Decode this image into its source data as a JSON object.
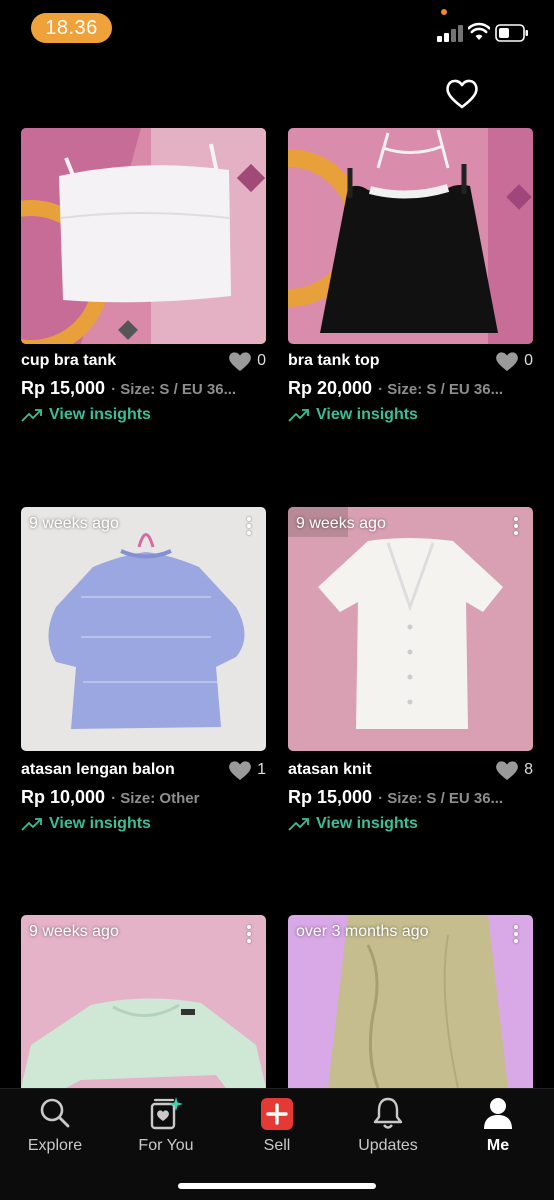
{
  "status_bar": {
    "time": "18.36",
    "time_pill_color": "#f0a23a"
  },
  "header": {
    "icon": "heart-outline-icon"
  },
  "colors": {
    "accent_green": "#3bbf98",
    "background": "#000000",
    "sell_red": "#e53935"
  },
  "listings": [
    {
      "title": "cup bra tank",
      "likes": "0",
      "price": "Rp 15,000",
      "size": "· Size: S / EU 36...",
      "insights": "View insights",
      "posted": ""
    },
    {
      "title": "bra tank top",
      "likes": "0",
      "price": "Rp 20,000",
      "size": "· Size: S / EU 36...",
      "insights": "View insights",
      "posted": ""
    },
    {
      "title": "atasan lengan balon",
      "likes": "1",
      "price": "Rp 10,000",
      "size": "· Size: Other",
      "insights": "View insights",
      "posted": "9 weeks ago"
    },
    {
      "title": "atasan knit",
      "likes": "8",
      "price": "Rp 15,000",
      "size": "· Size: S / EU 36...",
      "insights": "View insights",
      "posted": "9 weeks ago"
    },
    {
      "title": "",
      "likes": "",
      "price": "",
      "size": "",
      "insights": "",
      "posted": "9 weeks ago"
    },
    {
      "title": "",
      "likes": "",
      "price": "",
      "size": "",
      "insights": "",
      "posted": "over 3 months ago"
    }
  ],
  "bottom_nav": [
    {
      "label": "Explore",
      "icon": "search-icon",
      "active": false
    },
    {
      "label": "For You",
      "icon": "for-you-icon",
      "active": false
    },
    {
      "label": "Sell",
      "icon": "sell-plus-icon",
      "active": false
    },
    {
      "label": "Updates",
      "icon": "bell-icon",
      "active": false
    },
    {
      "label": "Me",
      "icon": "profile-icon",
      "active": true
    }
  ]
}
